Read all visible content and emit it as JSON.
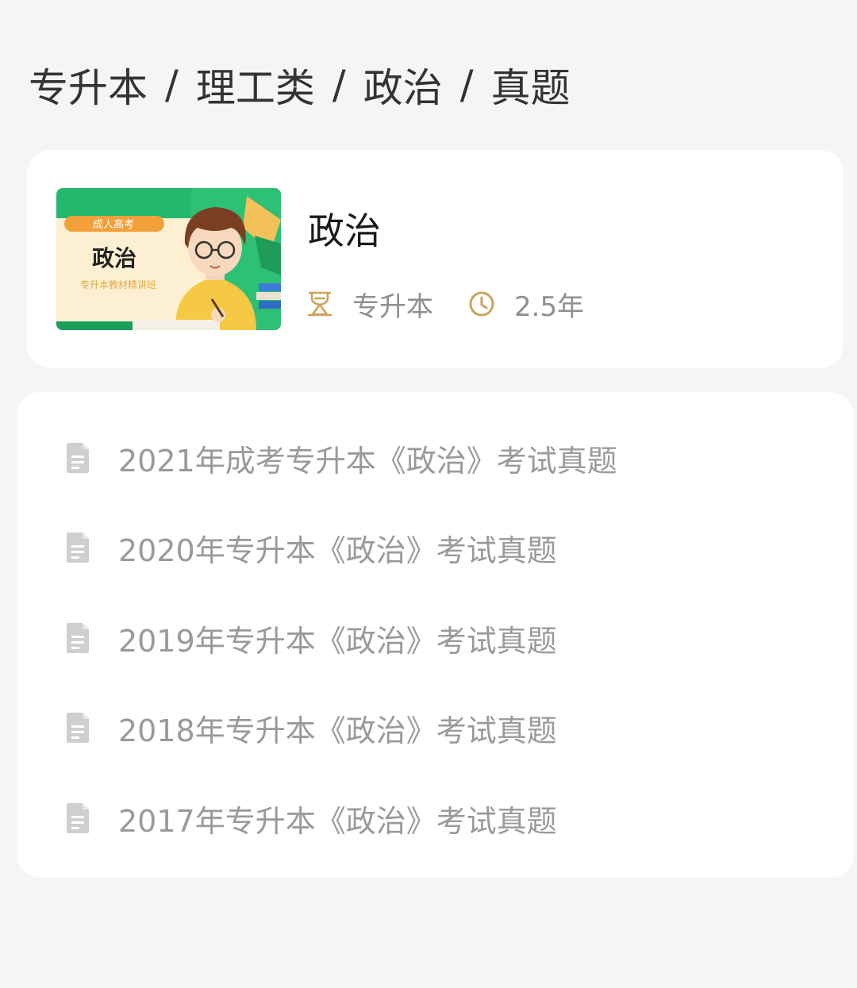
{
  "breadcrumb": {
    "items": [
      "专升本",
      "理工类",
      "政治",
      "真题"
    ],
    "separator": "/"
  },
  "course": {
    "title": "政治",
    "thumbnail": {
      "tag": "成人高考",
      "title": "政治",
      "subtitle": "专升本教材精讲班"
    },
    "level_icon": "graduation-level-icon",
    "level_label": "专升本",
    "duration_icon": "clock-icon",
    "duration_label": "2.5年",
    "accent_color": "#c9a45c"
  },
  "papers": {
    "icon": "document-icon",
    "items": [
      {
        "label": "2021年成考专升本《政治》考试真题"
      },
      {
        "label": "2020年专升本《政治》考试真题"
      },
      {
        "label": "2019年专升本《政治》考试真题"
      },
      {
        "label": "2018年专升本《政治》考试真题"
      },
      {
        "label": "2017年专升本《政治》考试真题"
      }
    ]
  },
  "colors": {
    "background": "#f5f5f5",
    "card": "#ffffff",
    "list_text": "#9a9a9a",
    "icon_gray": "#cfcfcf",
    "thumbnail_green": "#23b86d"
  }
}
